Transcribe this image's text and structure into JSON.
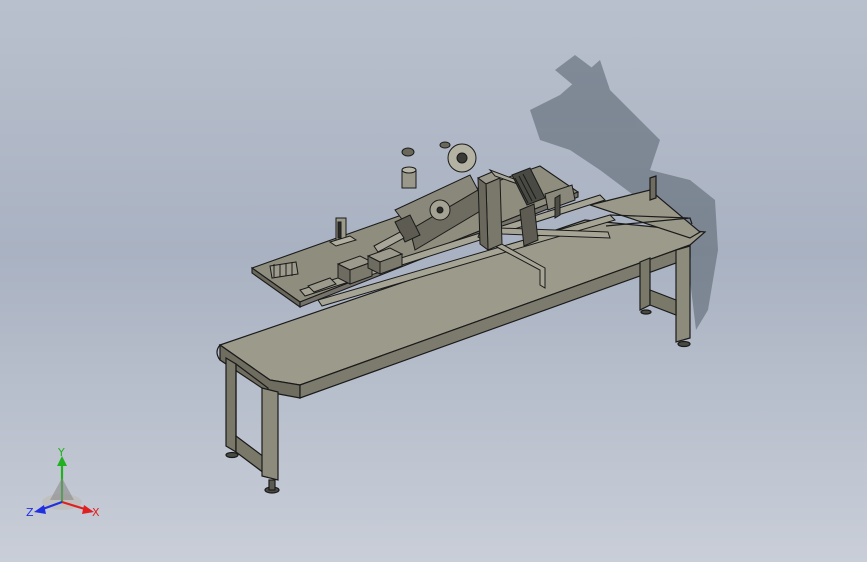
{
  "triad": {
    "x_label": "X",
    "y_label": "Y",
    "z_label": "Z",
    "x_color": "#e02020",
    "y_color": "#20b020",
    "z_color": "#2030e0"
  },
  "scene": {
    "background_top": "#b9c0cd",
    "background_bottom": "#c9ced8",
    "model_color": "#8d8b7c",
    "edge_color": "#1a1a1a"
  }
}
